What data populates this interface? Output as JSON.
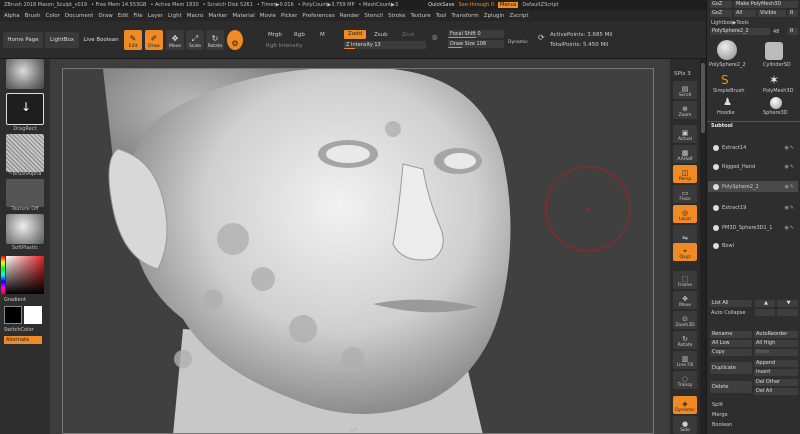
{
  "titlebar": {
    "app": "ZBrush 2018 Mason_Sculpt_v019",
    "freemem": "• Free Mem 14.553GB",
    "activemem": "• Active Mem 1830",
    "scratch": "• Scratch Disk 5261",
    "timer": "• Timer▶0.016",
    "polycount": "• PolyCount▶3.759 MP",
    "meshcount": "• MeshCount▶3",
    "quicksave": "QuickSave",
    "seethrough": "See-through 0",
    "menus": "Menus",
    "defaultzscript": "DefaultZScript"
  },
  "menubar": [
    "Alpha",
    "Brush",
    "Color",
    "Document",
    "Draw",
    "Edit",
    "File",
    "Layer",
    "Light",
    "Macro",
    "Marker",
    "Material",
    "Movie",
    "Picker",
    "Preferences",
    "Render",
    "Stencil",
    "Stroke",
    "Texture",
    "Tool",
    "Transform",
    "Zplugin",
    "Zscript"
  ],
  "toolbar": {
    "home": "Home Page",
    "lightbox": "LightBox",
    "liveboolean": "Live Boolean",
    "edit": "Edit",
    "draw": "Draw",
    "move": "Move",
    "scale": "Scale",
    "rotate": "Rotate",
    "mrgb": "Mrgb",
    "rgb": "Rgb",
    "m": "M",
    "rgb_intensity": "Rgb Intensity",
    "zadd": "Zadd",
    "zsub": "Zsub",
    "zcut": "Zcut",
    "z_intensity": "Z Intensity 13",
    "focal_shift": "Focal Shift 0",
    "draw_size_label": "Draw Size",
    "draw_size_value": "108",
    "dynamic": "Dynamic",
    "active_points": "ActivePoints: 3.685 Mil",
    "total_points": "TotalPoints: 5.450 Mil"
  },
  "leftpanel": {
    "dragrect": "DragRect",
    "brushalpha": "~BrushAlpha",
    "texture_off": "Texture Off",
    "softplastic": "SoftPlastic",
    "gradient": "Gradient",
    "switchcolor": "SwitchColor",
    "alternate": "Alternate"
  },
  "rightstrip": {
    "spix": "SPix 3",
    "scroll": "Scroll",
    "zoom": "Zoom",
    "actual": "Actual",
    "aahalf": "AAHalf",
    "persp": "Persp",
    "floor": "Floor",
    "local": "Local",
    "xyz": "Qxyz",
    "frame": "Frame",
    "move": "Move",
    "zoom3d": "Zoom3D",
    "rotate": "Rotate",
    "linefill": "Line Fill",
    "polyf": "PolyF",
    "transp": "Transp",
    "ghost": "Ghost",
    "dynamic": "Dynamic",
    "solo": "Solo"
  },
  "rightpanel": {
    "goz": "GoZ",
    "make_polymesh": "Make PolyMesh3D",
    "goz2": "GoZ",
    "all": "All",
    "visible": "Visible",
    "r": "R",
    "lightbox_tools": "Lightbox▶Tools",
    "polysphere_current": "PolySphere2_2",
    "slider_value": "48",
    "r2": "R",
    "tools": [
      "PolySphere2_2",
      "CylinderSD",
      "SimpleBrush",
      "PolyMesh3D",
      "Hoodie",
      "Sphere3D"
    ],
    "subtool_header": "Subtool",
    "subtools": [
      "Extract14",
      "Rigged_Hand",
      "PolySphere2_2",
      "Extract19",
      "PM3D_Sphere3D1_1",
      "Bowl"
    ],
    "list_all": "List All",
    "auto_collapse": "Auto Collapse",
    "rename": "Rename",
    "autoreorder": "AutoReorder",
    "all_low": "All Low",
    "all_high": "All High",
    "copy": "Copy",
    "paste": "Paste",
    "duplicate": "Duplicate",
    "append": "Append",
    "insert": "Insert",
    "delete": "Delete",
    "del_other": "Del Other",
    "del_all": "Del All",
    "split": "Split",
    "merge": "Merge",
    "boolean": "Boolean"
  },
  "canvas": {
    "bottom_label": "▲▼"
  },
  "colors": {
    "accent": "#f08a24",
    "panel": "#2e2e2e",
    "canvas": "#404040"
  }
}
